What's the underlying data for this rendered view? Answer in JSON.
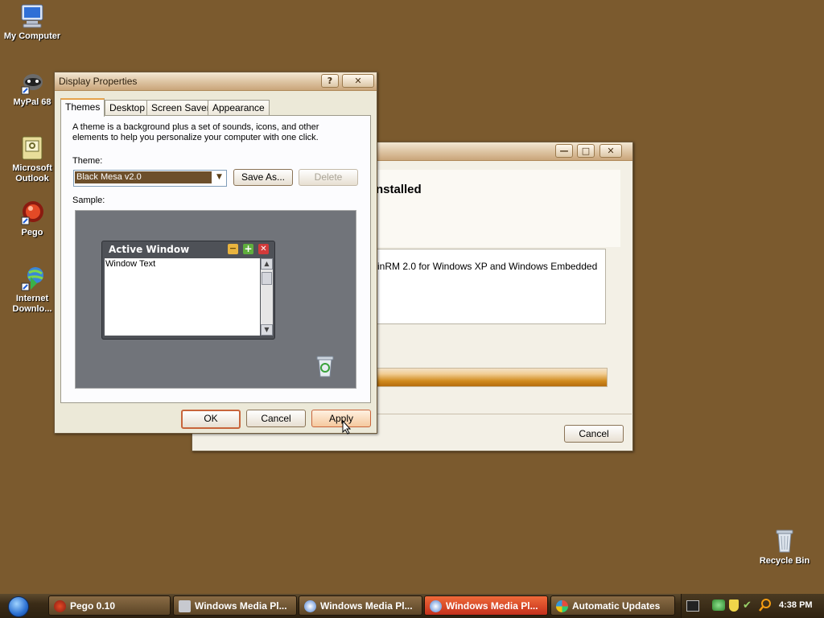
{
  "desktop": {
    "icons": [
      {
        "label": "My Computer",
        "icon": "my-computer-icon"
      },
      {
        "label": "MyPal 68",
        "icon": "mypal-icon"
      },
      {
        "label": "Microsoft Outlook",
        "icon": "outlook-icon"
      },
      {
        "label": "Pego",
        "icon": "pego-icon"
      },
      {
        "label": "Internet Downlo...",
        "icon": "internet-download-icon"
      },
      {
        "label": "Recycle Bin",
        "icon": "recycle-bin-icon"
      }
    ]
  },
  "display_properties": {
    "title": "Display Properties",
    "help_btn": "?",
    "close_btn": "✕",
    "tabs": [
      "Themes",
      "Desktop",
      "Screen Saver",
      "Appearance"
    ],
    "description": "A theme is a background plus a set of sounds, icons, and other elements to help you personalize your computer with one click.",
    "theme_label": "Theme:",
    "theme_value": "Black Mesa v2.0",
    "save_as": "Save As...",
    "delete": "Delete",
    "sample_label": "Sample:",
    "sample_window_title": "Active Window",
    "sample_window_text": "Window Text",
    "ok": "OK",
    "cancel": "Cancel",
    "apply": "Apply"
  },
  "installer": {
    "heading": "nstalled",
    "item_text": "inRM 2.0 for Windows XP and Windows Embedded",
    "cancel": "Cancel",
    "progress": 1.0
  },
  "taskbar": {
    "tasks": [
      {
        "label": "Pego 0.10",
        "icon": "pego-icon",
        "active": false
      },
      {
        "label": "Windows Media Pl...",
        "icon": "media-player-icon",
        "active": false
      },
      {
        "label": "Windows Media Pl...",
        "icon": "media-player-icon",
        "active": false
      },
      {
        "label": "Windows Media Pl...",
        "icon": "media-player-icon",
        "active": true
      },
      {
        "label": "Automatic Updates",
        "icon": "windows-update-icon",
        "active": false
      }
    ],
    "clock": "4:38 PM"
  },
  "colors": {
    "desktop": "#7b5a2e",
    "active_task": "#d5401f",
    "accent": "#e6a24b"
  }
}
